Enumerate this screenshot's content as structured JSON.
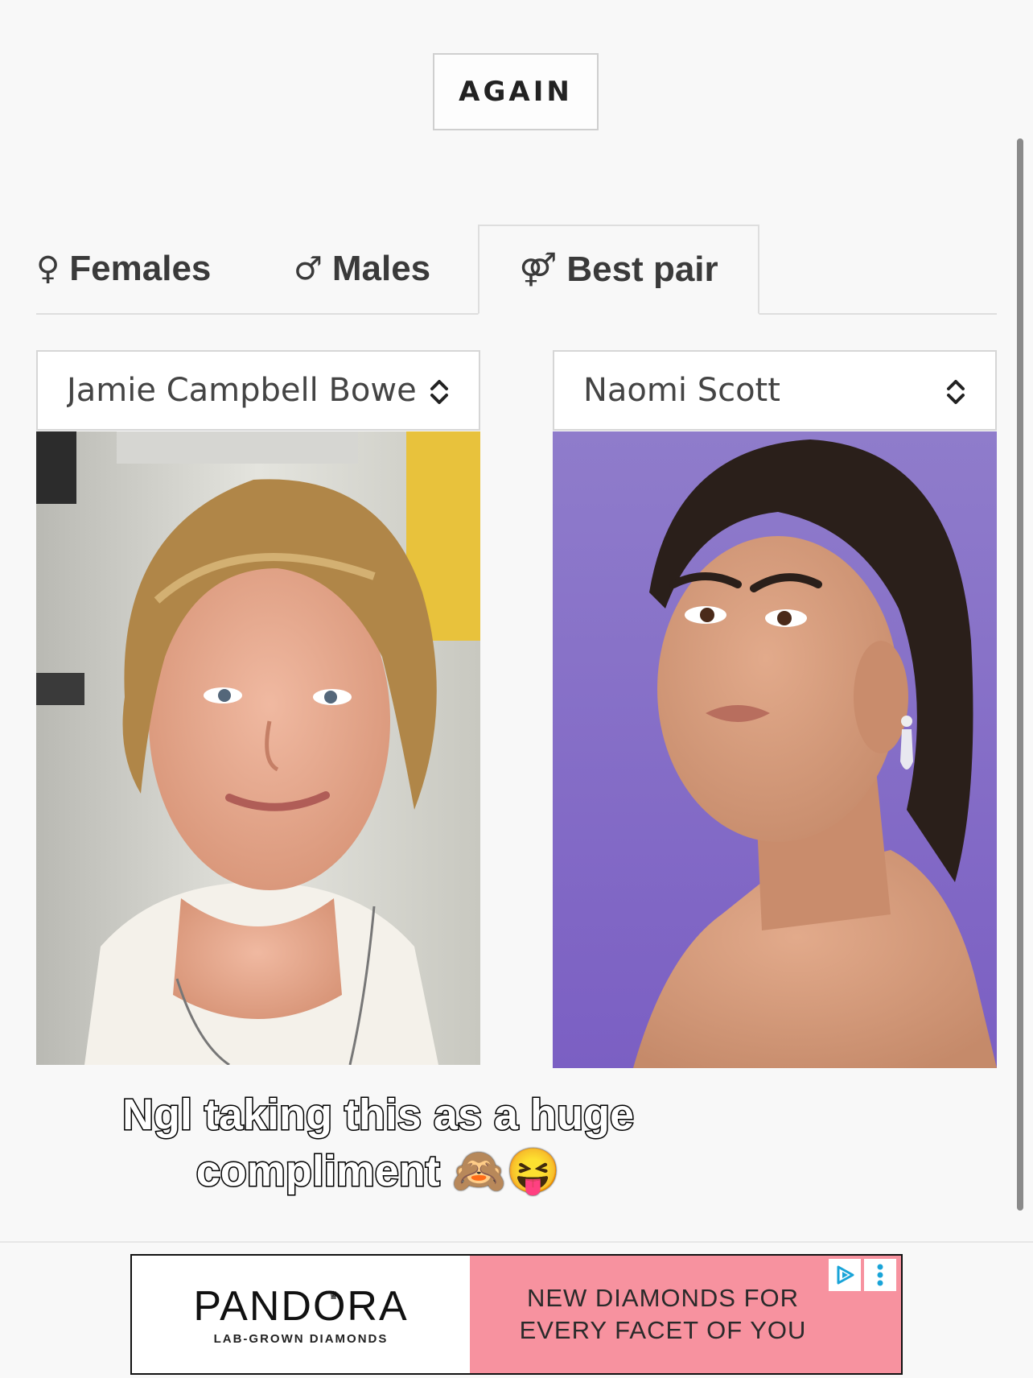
{
  "again_button": {
    "label": "AGAIN"
  },
  "tabs": [
    {
      "symbol": "♀",
      "label": "Females",
      "active": false
    },
    {
      "symbol": "♂",
      "label": "Males",
      "active": false
    },
    {
      "symbol": "⚤",
      "label": "Best pair",
      "active": true
    }
  ],
  "selects": {
    "left": {
      "value": "Jamie Campbell Bower"
    },
    "right": {
      "value": "Naomi Scott"
    }
  },
  "caption": {
    "line1": "Ngl taking this as a huge",
    "line2": "compliment 🙈😝"
  },
  "ad": {
    "brand": "PANDORA",
    "subtitle": "LAB-GROWN DIAMONDS",
    "headline": "NEW DIAMONDS FOR EVERY FACET OF YOU",
    "accent_color": "#f7929f",
    "icons": [
      "adchoices-icon",
      "more-options-icon"
    ]
  }
}
